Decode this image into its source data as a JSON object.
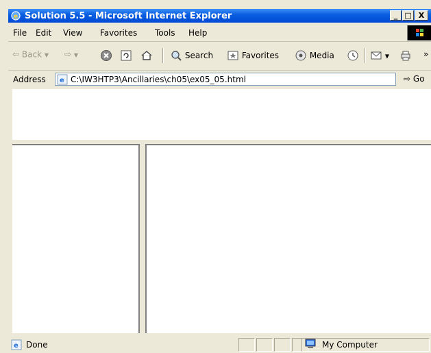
{
  "window": {
    "title": "Solution 5.5 - Microsoft Internet Explorer"
  },
  "titlebar_buttons": {
    "minimize": "_",
    "maximize": "□",
    "close": "X"
  },
  "menu": {
    "items": [
      {
        "label": "File"
      },
      {
        "label": "Edit"
      },
      {
        "label": "View"
      },
      {
        "label": "Favorites"
      },
      {
        "label": "Tools"
      },
      {
        "label": "Help"
      }
    ]
  },
  "toolbar": {
    "back": "Back",
    "search": "Search",
    "favorites": "Favorites",
    "media": "Media",
    "overflow": "»"
  },
  "address": {
    "label": "Address",
    "url": "C:\\IW3HTP3\\Ancillaries\\ch05\\ex05_05.html",
    "go": "Go"
  },
  "status": {
    "text": "Done",
    "zone": "My Computer"
  },
  "colors": {
    "titlebar": "#0a5fe0",
    "chrome": "#ece9d8",
    "frame_border": "#808080"
  }
}
